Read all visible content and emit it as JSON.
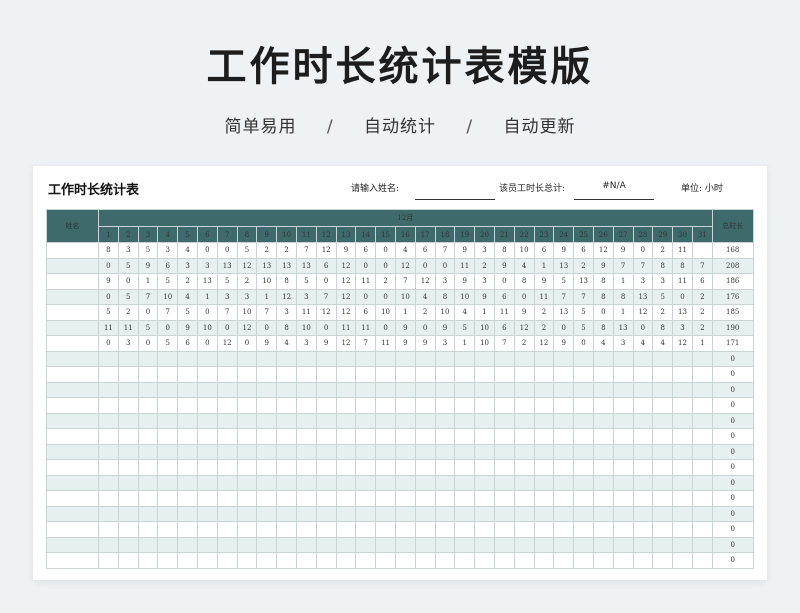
{
  "page": {
    "title": "工作时长统计表模版",
    "features": [
      "简单易用",
      "自动统计",
      "自动更新"
    ],
    "separator": "/"
  },
  "sheet": {
    "title": "工作时长统计表",
    "name_prompt": "请输入姓名:",
    "name_value": "",
    "total_label": "该员工时长总计:",
    "total_value": "#N/A",
    "unit_label": "单位: 小时"
  },
  "table": {
    "name_header": "姓名",
    "month_header": "12月",
    "total_header": "总时长",
    "days": [
      "1",
      "2",
      "3",
      "4",
      "5",
      "6",
      "7",
      "8",
      "9",
      "10",
      "11",
      "12",
      "13",
      "14",
      "15",
      "16",
      "17",
      "18",
      "19",
      "20",
      "21",
      "22",
      "23",
      "24",
      "25",
      "26",
      "27",
      "28",
      "29",
      "30",
      "31"
    ],
    "rows": [
      {
        "name": "",
        "values": [
          "8",
          "3",
          "5",
          "3",
          "4",
          "0",
          "0",
          "5",
          "2",
          "2",
          "7",
          "12",
          "9",
          "6",
          "0",
          "4",
          "6",
          "7",
          "9",
          "3",
          "8",
          "10",
          "6",
          "9",
          "6",
          "12",
          "9",
          "0",
          "2",
          "11"
        ],
        "total": "168"
      },
      {
        "name": "",
        "values": [
          "0",
          "5",
          "9",
          "6",
          "3",
          "3",
          "13",
          "12",
          "13",
          "13",
          "13",
          "6",
          "12",
          "0",
          "0",
          "12",
          "0",
          "0",
          "11",
          "2",
          "9",
          "4",
          "1",
          "13",
          "2",
          "9",
          "7",
          "7",
          "8",
          "8",
          "7"
        ],
        "total": "208"
      },
      {
        "name": "",
        "values": [
          "9",
          "0",
          "1",
          "5",
          "2",
          "13",
          "5",
          "2",
          "10",
          "8",
          "5",
          "0",
          "12",
          "11",
          "2",
          "7",
          "12",
          "3",
          "9",
          "3",
          "0",
          "8",
          "9",
          "5",
          "13",
          "8",
          "1",
          "3",
          "3",
          "11",
          "6"
        ],
        "total": "186"
      },
      {
        "name": "",
        "values": [
          "0",
          "5",
          "7",
          "10",
          "4",
          "1",
          "3",
          "3",
          "1",
          "12",
          "3",
          "7",
          "12",
          "0",
          "0",
          "10",
          "4",
          "8",
          "10",
          "9",
          "6",
          "0",
          "11",
          "7",
          "7",
          "8",
          "8",
          "13",
          "5",
          "0",
          "2"
        ],
        "total": "176"
      },
      {
        "name": "",
        "values": [
          "5",
          "2",
          "0",
          "7",
          "5",
          "0",
          "7",
          "10",
          "7",
          "3",
          "11",
          "12",
          "12",
          "6",
          "10",
          "1",
          "2",
          "10",
          "4",
          "1",
          "11",
          "9",
          "2",
          "13",
          "5",
          "0",
          "1",
          "12",
          "2",
          "13",
          "2"
        ],
        "total": "185"
      },
      {
        "name": "",
        "values": [
          "11",
          "11",
          "5",
          "0",
          "9",
          "10",
          "0",
          "12",
          "0",
          "8",
          "10",
          "0",
          "11",
          "11",
          "0",
          "9",
          "0",
          "9",
          "5",
          "10",
          "6",
          "12",
          "2",
          "0",
          "5",
          "8",
          "13",
          "0",
          "8",
          "3",
          "2"
        ],
        "total": "190"
      },
      {
        "name": "",
        "values": [
          "0",
          "3",
          "0",
          "5",
          "6",
          "0",
          "12",
          "0",
          "9",
          "4",
          "3",
          "9",
          "12",
          "7",
          "11",
          "9",
          "9",
          "3",
          "1",
          "10",
          "7",
          "2",
          "12",
          "9",
          "0",
          "4",
          "3",
          "4",
          "4",
          "12",
          "1"
        ],
        "total": "171"
      },
      {
        "name": "",
        "values": [],
        "total": "0"
      },
      {
        "name": "",
        "values": [],
        "total": "0"
      },
      {
        "name": "",
        "values": [],
        "total": "0"
      },
      {
        "name": "",
        "values": [],
        "total": "0"
      },
      {
        "name": "",
        "values": [],
        "total": "0"
      },
      {
        "name": "",
        "values": [],
        "total": "0"
      },
      {
        "name": "",
        "values": [],
        "total": "0"
      },
      {
        "name": "",
        "values": [],
        "total": "0"
      },
      {
        "name": "",
        "values": [],
        "total": "0"
      },
      {
        "name": "",
        "values": [],
        "total": "0"
      },
      {
        "name": "",
        "values": [],
        "total": "0"
      },
      {
        "name": "",
        "values": [],
        "total": "0"
      },
      {
        "name": "",
        "values": [],
        "total": "0"
      },
      {
        "name": "",
        "values": [],
        "total": "0"
      }
    ]
  }
}
